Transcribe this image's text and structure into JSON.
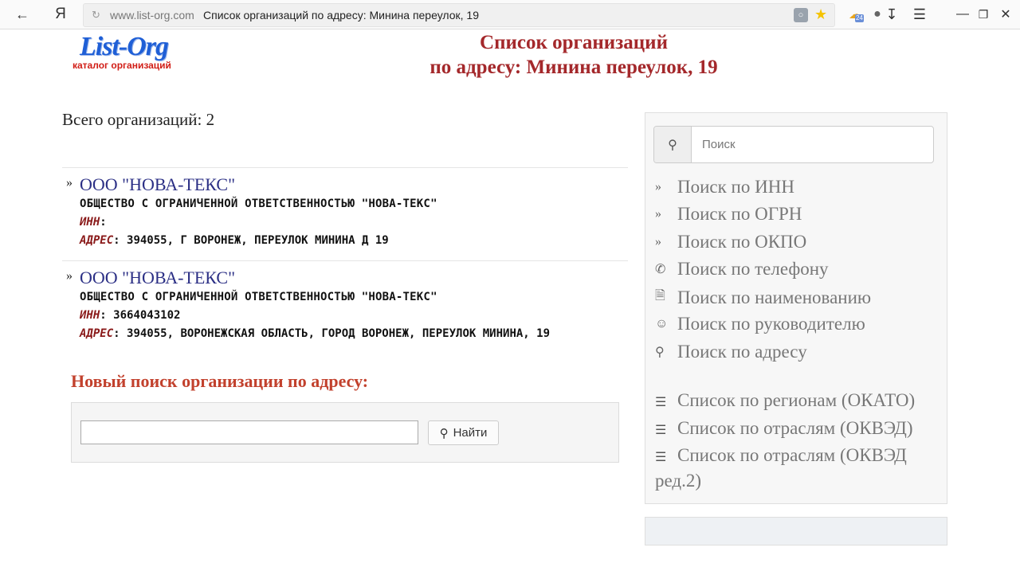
{
  "browser": {
    "logo": "Я",
    "domain": "www.list-org.com",
    "title": "Список организаций по адресу: Минина переулок, 19",
    "weather_badge": "24"
  },
  "header": {
    "logo_main": "List-Org",
    "logo_sub": "каталог организаций",
    "heading_line1": "Список организаций",
    "heading_line2": "по адресу: Минина переулок, 19"
  },
  "main": {
    "total": "Всего организаций: 2",
    "organizations": [
      {
        "name": "ООО \"НОВА-ТЕКС\"",
        "full_name": "ОБЩЕСТВО С ОГРАНИЧЕННОЙ ОТВЕТСТВЕННОСТЬЮ \"НОВА-ТЕКС\"",
        "inn_label": "ИНН",
        "inn": "",
        "address_label": "АДРЕС",
        "address": "394055, Г ВОРОНЕЖ, ПЕРЕУЛОК МИНИНА Д 19"
      },
      {
        "name": "ООО \"НОВА-ТЕКС\"",
        "full_name": "ОБЩЕСТВО С ОГРАНИЧЕННОЙ ОТВЕТСТВЕННОСТЬЮ \"НОВА-ТЕКС\"",
        "inn_label": "ИНН",
        "inn": "3664043102",
        "address_label": "АДРЕС",
        "address": "394055, ВОРОНЕЖСКАЯ ОБЛАСТЬ, ГОРОД ВОРОНЕЖ, ПЕРЕУЛОК МИНИНА, 19"
      }
    ],
    "new_search_title": "Новый поиск организации по адресу:",
    "new_search_value": "",
    "find_button": "Найти"
  },
  "sidebar": {
    "search_placeholder": "Поиск",
    "links": [
      {
        "icon": "double-chevron-icon",
        "label": "Поиск по ИНН"
      },
      {
        "icon": "double-chevron-icon",
        "label": "Поиск по ОГРН"
      },
      {
        "icon": "double-chevron-icon",
        "label": "Поиск по ОКПО"
      },
      {
        "icon": "phone-icon",
        "label": "Поиск по телефону"
      },
      {
        "icon": "document-icon",
        "label": "Поиск по наименованию"
      },
      {
        "icon": "user-icon",
        "label": "Поиск по руководителю"
      },
      {
        "icon": "map-marker-icon",
        "label": "Поиск по адресу"
      }
    ],
    "lists": [
      {
        "icon": "list-icon",
        "label": "Список по регионам (ОКАТО)"
      },
      {
        "icon": "list-icon",
        "label": "Список по отраслям (ОКВЭД)"
      },
      {
        "icon": "list-icon",
        "label": "Список по отраслям (ОКВЭД ред.2)"
      }
    ]
  },
  "colors": {
    "heading": "#a4282b",
    "org_link": "#2b2f85",
    "label": "#8a1a1a",
    "new_search_title": "#c2412d",
    "logo_blue": "#1f5fd6",
    "logo_red": "#d11d16"
  }
}
